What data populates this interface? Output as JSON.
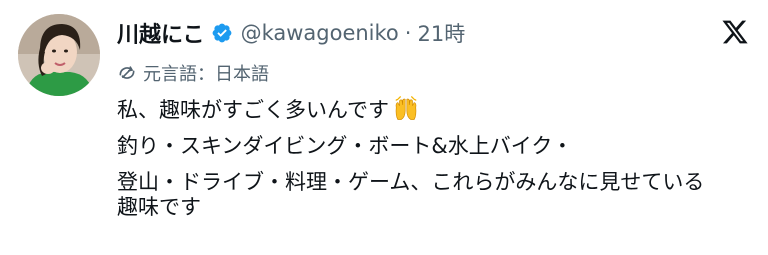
{
  "author": {
    "display_name": "川越にこ",
    "handle": "@kawagoeniko",
    "separator": "·",
    "time": "21時"
  },
  "translation": {
    "label": "元言語：日本語"
  },
  "post": {
    "line1": "私、趣味がすごく多いんです",
    "line1_emoji": "raised-hands-emoji",
    "line2": "釣り・スキンダイビング・ボート&水上バイク・",
    "line3": "登山・ドライブ・料理・ゲーム、これらがみんなに見せている",
    "line4": "趣味です"
  },
  "icons": {
    "verified": "verified-badge-icon",
    "brand": "x-logo-icon",
    "translate": "translate-icon"
  },
  "colors": {
    "verified_blue": "#1d9bf0",
    "text_primary": "#0f1419",
    "text_secondary": "#536471",
    "accent_green": "#2d9b45"
  }
}
